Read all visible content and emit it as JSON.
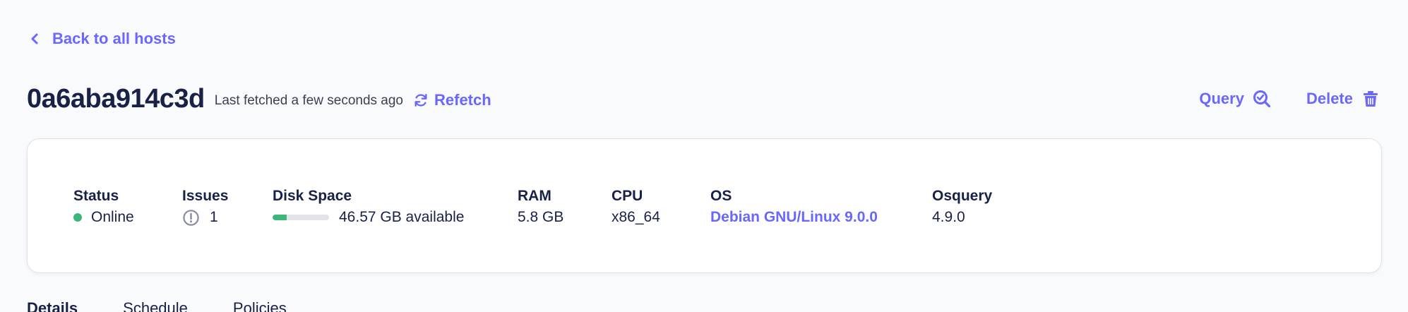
{
  "nav": {
    "back_label": "Back to all hosts"
  },
  "header": {
    "host_name": "0a6aba914c3d",
    "last_fetched": "Last fetched a few seconds ago",
    "refetch_label": "Refetch",
    "query_label": "Query",
    "delete_label": "Delete"
  },
  "summary": {
    "status": {
      "label": "Status",
      "value": "Online",
      "color": "#3db67b"
    },
    "issues": {
      "label": "Issues",
      "value": "1"
    },
    "disk": {
      "label": "Disk Space",
      "value": "46.57 GB available",
      "used_fraction": 0.25
    },
    "ram": {
      "label": "RAM",
      "value": "5.8 GB"
    },
    "cpu": {
      "label": "CPU",
      "value": "x86_64"
    },
    "os": {
      "label": "OS",
      "value": "Debian GNU/Linux 9.0.0"
    },
    "osquery": {
      "label": "Osquery",
      "value": "4.9.0"
    }
  },
  "tabs": [
    {
      "label": "Details"
    },
    {
      "label": "Schedule"
    },
    {
      "label": "Policies"
    }
  ],
  "colors": {
    "accent": "#6a67fe",
    "text": "#192147",
    "online": "#3db67b"
  }
}
